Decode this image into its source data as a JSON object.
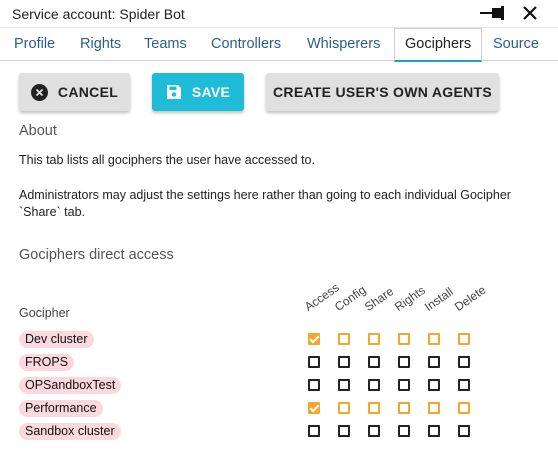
{
  "window": {
    "title": "Service account: Spider Bot",
    "pin_icon": "pin-icon",
    "close_icon": "close-icon"
  },
  "tabs": [
    {
      "label": "Profile",
      "active": false
    },
    {
      "label": "Rights",
      "active": false
    },
    {
      "label": "Teams",
      "active": false
    },
    {
      "label": "Controllers",
      "active": false
    },
    {
      "label": "Whisperers",
      "active": false
    },
    {
      "label": "Gociphers",
      "active": true
    },
    {
      "label": "Source",
      "active": false
    }
  ],
  "actions": {
    "cancel_label": "CANCEL",
    "save_label": "SAVE",
    "create_agents_label": "CREATE USER'S OWN AGENTS"
  },
  "about": {
    "heading": "About",
    "text1": "This tab lists all gociphers the user have accessed to.",
    "text2": "Administrators may adjust the settings here rather than going to each individual Gocipher `Share` tab."
  },
  "access": {
    "heading": "Gociphers direct access",
    "row_header": "Gocipher",
    "columns": [
      "Access",
      "Config",
      "Share",
      "Rights",
      "Install",
      "Delete"
    ],
    "rows": [
      {
        "name": "Dev cluster",
        "access": true
      },
      {
        "name": "FROPS",
        "access": false
      },
      {
        "name": "OPSandboxTest",
        "access": false
      },
      {
        "name": "Performance",
        "access": true
      },
      {
        "name": "Sandbox cluster",
        "access": false
      }
    ]
  },
  "colors": {
    "accent": "#1ebcd7",
    "checkbox_checked": "#f0a830",
    "chip_background": "#fad8df",
    "tab_text": "#2a5f8a"
  }
}
